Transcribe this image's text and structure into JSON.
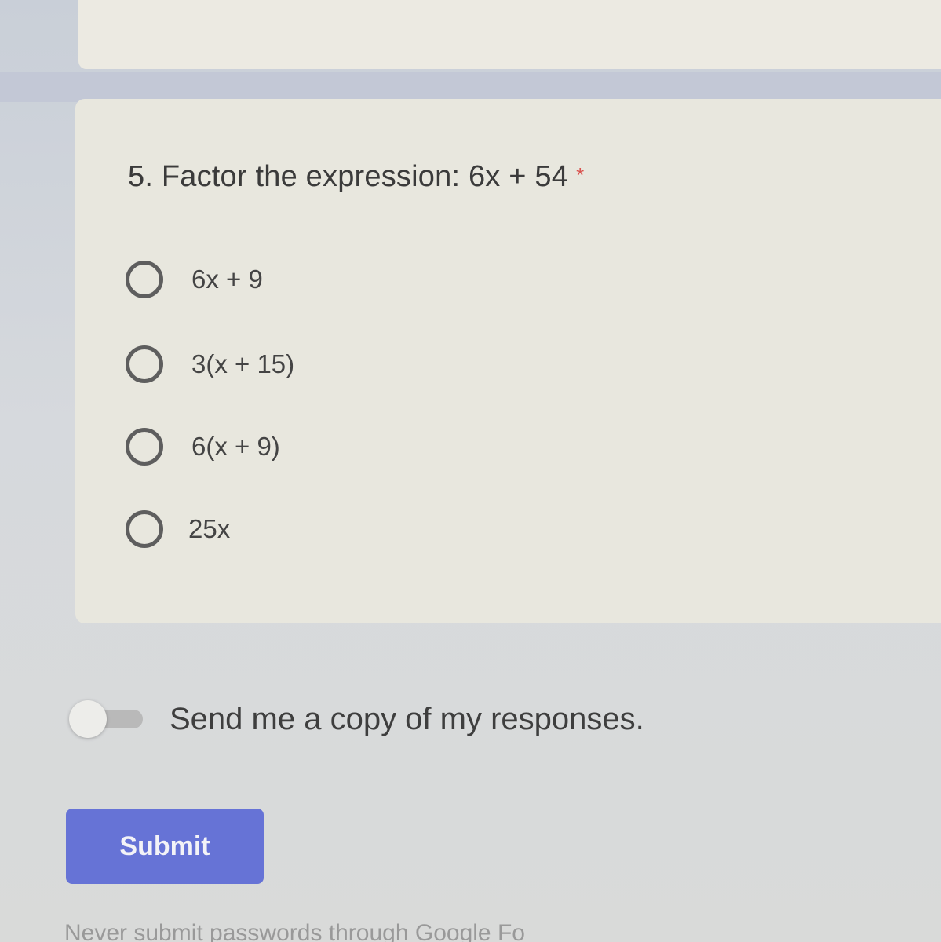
{
  "question": {
    "number_and_text": "5. Factor the expression: 6x + 54",
    "required_marker": "*",
    "options": [
      {
        "label": "6x + 9",
        "selected": false
      },
      {
        "label": "3(x + 15)",
        "selected": false
      },
      {
        "label": "6(x + 9)",
        "selected": false
      },
      {
        "label": "25x",
        "selected": false
      }
    ]
  },
  "send_copy": {
    "label": "Send me a copy of my responses.",
    "enabled": false
  },
  "submit_label": "Submit",
  "footer_note": "Never submit passwords through Google Fo",
  "colors": {
    "submit_button": "#6673d6",
    "card_background": "#e8e7de",
    "required_star": "#d9534f"
  }
}
